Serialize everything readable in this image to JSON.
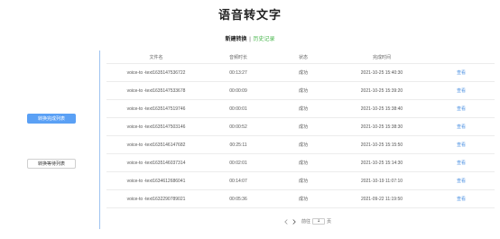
{
  "app": {
    "title": "语音转文字"
  },
  "subnav": {
    "current": "新建转换",
    "separator": "|",
    "history_link": "历史记录"
  },
  "sidebar": {
    "primary_button": "转换完成列表",
    "secondary_button": "转换等待列表"
  },
  "table": {
    "headers": [
      "文件名",
      "音频时长",
      "状态",
      "完成时间",
      ""
    ],
    "rows": [
      {
        "filename": "voice-to -text1635147536722",
        "duration": "00:13:27",
        "status": "成功",
        "completed": "2021-10-25 15:40:30",
        "action": "查看"
      },
      {
        "filename": "voice-to -text1635147533678",
        "duration": "00:00:09",
        "status": "成功",
        "completed": "2021-10-25 15:39:20",
        "action": "查看"
      },
      {
        "filename": "voice-to -text1635147519746",
        "duration": "00:00:01",
        "status": "成功",
        "completed": "2021-10-25 15:38:40",
        "action": "查看"
      },
      {
        "filename": "voice-to -text1635147503146",
        "duration": "00:00:52",
        "status": "成功",
        "completed": "2021-10-25 15:38:30",
        "action": "查看"
      },
      {
        "filename": "voice-to -text1635146147682",
        "duration": "00:25:11",
        "status": "成功",
        "completed": "2021-10-25 15:15:50",
        "action": "查看"
      },
      {
        "filename": "voice-to -text1635146037314",
        "duration": "00:02:01",
        "status": "成功",
        "completed": "2021-10-25 15:14:30",
        "action": "查看"
      },
      {
        "filename": "voice-to -text1634612686041",
        "duration": "00:14:07",
        "status": "成功",
        "completed": "2021-10-19 11:07:10",
        "action": "查看"
      },
      {
        "filename": "voice-to -text1632290789021",
        "duration": "00:05:36",
        "status": "成功",
        "completed": "2021-09-22 11:19:50",
        "action": "查看"
      }
    ]
  },
  "pagination": {
    "goto_label": "前往",
    "page_value": "1",
    "page_suffix": "页"
  },
  "colors": {
    "accent_green": "#44b549",
    "primary_blue": "#5aa0f5",
    "link_blue": "#4a90e2"
  },
  "icons": {
    "prev": "chevron-left-icon",
    "next": "chevron-right-icon"
  }
}
